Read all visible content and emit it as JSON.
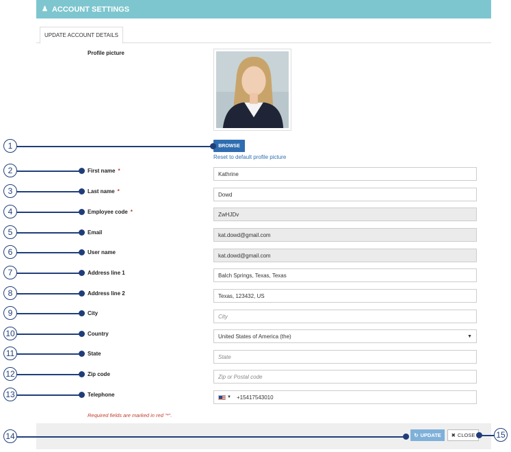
{
  "header": {
    "title": "ACCOUNT SETTINGS",
    "icon": "user-icon"
  },
  "tabs": [
    {
      "label": "UPDATE ACCOUNT DETAILS"
    }
  ],
  "profile": {
    "label": "Profile picture",
    "browse_label": "BROWSE",
    "reset_label": "Reset to default profile picture"
  },
  "fields": {
    "first_name": {
      "label": "First name",
      "value": "Kathrine",
      "required": "*"
    },
    "last_name": {
      "label": "Last name",
      "value": "Dowd",
      "required": "*"
    },
    "employee_code": {
      "label": "Employee code",
      "value": "ZwHJDv",
      "required": "*"
    },
    "email": {
      "label": "Email",
      "value": "kat.dowd@gmail.com"
    },
    "user_name": {
      "label": "User name",
      "value": "kat.dowd@gmail.com"
    },
    "address1": {
      "label": "Address line 1",
      "value": "Balch Springs, Texas, Texas"
    },
    "address2": {
      "label": "Address line 2",
      "value": "Texas, 123432, US"
    },
    "city": {
      "label": "City",
      "placeholder": "City"
    },
    "country": {
      "label": "Country",
      "value": "United States of America (the)"
    },
    "state": {
      "label": "State",
      "placeholder": "State"
    },
    "zip": {
      "label": "Zip code",
      "placeholder": "Zip or Postal code"
    },
    "telephone": {
      "label": "Telephone",
      "value": "+15417543010"
    }
  },
  "required_note": "Required fields are marked in red \"*\".",
  "footer": {
    "update_label": "UPDATE",
    "close_label": "CLOSE"
  },
  "callouts": [
    "1",
    "2",
    "3",
    "4",
    "5",
    "6",
    "7",
    "8",
    "9",
    "10",
    "11",
    "12",
    "13",
    "14",
    "15"
  ],
  "colors": {
    "header": "#7ec6cf",
    "primary": "#2f6db0",
    "callout": "#1f3d7a",
    "required": "#c0392b"
  }
}
